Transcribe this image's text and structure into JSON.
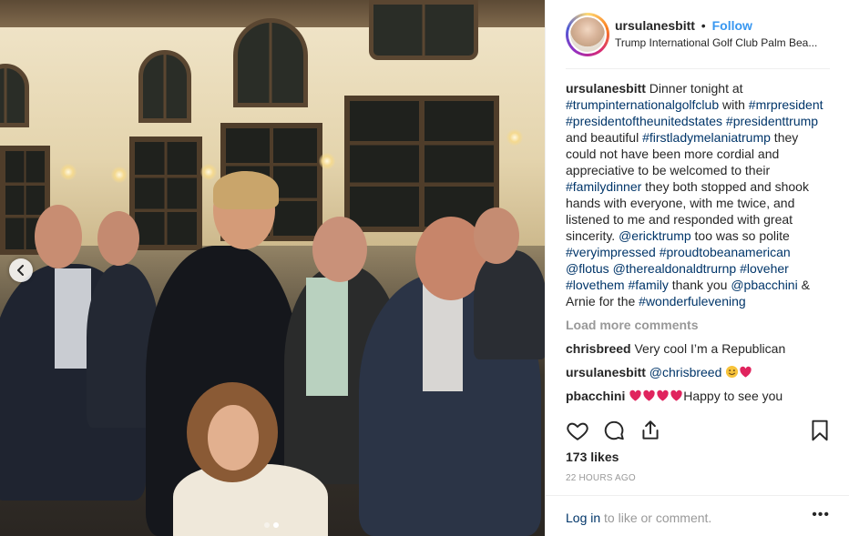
{
  "header": {
    "username": "ursulanesbitt",
    "separator": "•",
    "follow_label": "Follow",
    "location": "Trump International Golf Club Palm Bea..."
  },
  "caption": {
    "username": "ursulanesbitt",
    "segments": [
      {
        "text": "Dinner tonight at ",
        "tag": false
      },
      {
        "text": "#trumpinternationalgolfclub",
        "tag": true
      },
      {
        "text": " with ",
        "tag": false
      },
      {
        "text": "#mrpresident",
        "tag": true
      },
      {
        "text": " ",
        "tag": false
      },
      {
        "text": "#presidentoftheunitedstates",
        "tag": true
      },
      {
        "text": " ",
        "tag": false
      },
      {
        "text": "#presidenttrump",
        "tag": true
      },
      {
        "text": " and beautiful ",
        "tag": false
      },
      {
        "text": "#firstladymelaniatrump",
        "tag": true
      },
      {
        "text": " they could not have been more cordial and appreciative to be welcomed to their ",
        "tag": false
      },
      {
        "text": "#familydinner",
        "tag": true
      },
      {
        "text": " they both stopped and shook hands with everyone, with me twice, and listened to me and responded with great sincerity. ",
        "tag": false
      },
      {
        "text": "@ericktrump",
        "tag": true
      },
      {
        "text": " too was so polite ",
        "tag": false
      },
      {
        "text": "#veryimpressed",
        "tag": true
      },
      {
        "text": " ",
        "tag": false
      },
      {
        "text": "#proudtobeanamerican",
        "tag": true
      },
      {
        "text": " ",
        "tag": false
      },
      {
        "text": "@flotus",
        "tag": true
      },
      {
        "text": " ",
        "tag": false
      },
      {
        "text": "@therealdonaldtrurnp",
        "tag": true
      },
      {
        "text": " ",
        "tag": false
      },
      {
        "text": "#loveher",
        "tag": true
      },
      {
        "text": " ",
        "tag": false
      },
      {
        "text": "#lovethem",
        "tag": true
      },
      {
        "text": " ",
        "tag": false
      },
      {
        "text": "#family",
        "tag": true
      },
      {
        "text": " thank you ",
        "tag": false
      },
      {
        "text": "@pbacchini",
        "tag": true
      },
      {
        "text": " & Arnie for the ",
        "tag": false
      },
      {
        "text": "#wonderfulevening",
        "tag": true
      }
    ]
  },
  "load_more_label": "Load more comments",
  "comments": [
    {
      "username": "chrisbreed",
      "text": "Very cool I’m a Republican",
      "mention": "",
      "emojis": []
    },
    {
      "username": "ursulanesbitt",
      "text": "",
      "mention": "@chrisbreed",
      "emojis": [
        "smile-emoji",
        "heart-emoji"
      ]
    },
    {
      "username": "pbacchini",
      "text": "Happy to see you",
      "mention": "",
      "emojis": [
        "heart-emoji",
        "heart-emoji",
        "heart-emoji",
        "heart-emoji"
      ]
    }
  ],
  "likes": "173 likes",
  "timestamp": "22 HOURS AGO",
  "login": {
    "link": "Log in",
    "suffix": " to like or comment."
  },
  "more_label": "•••",
  "media": {
    "slide_count": 2,
    "active_slide": 2
  },
  "icons": {
    "like": "heart-icon",
    "comment": "comment-icon",
    "share": "share-icon",
    "save": "bookmark-icon",
    "prev": "chevron-left-icon"
  },
  "colors": {
    "link": "#003569",
    "follow": "#3897f0",
    "muted": "#999999",
    "text": "#262626",
    "heart": "#e0245e"
  }
}
